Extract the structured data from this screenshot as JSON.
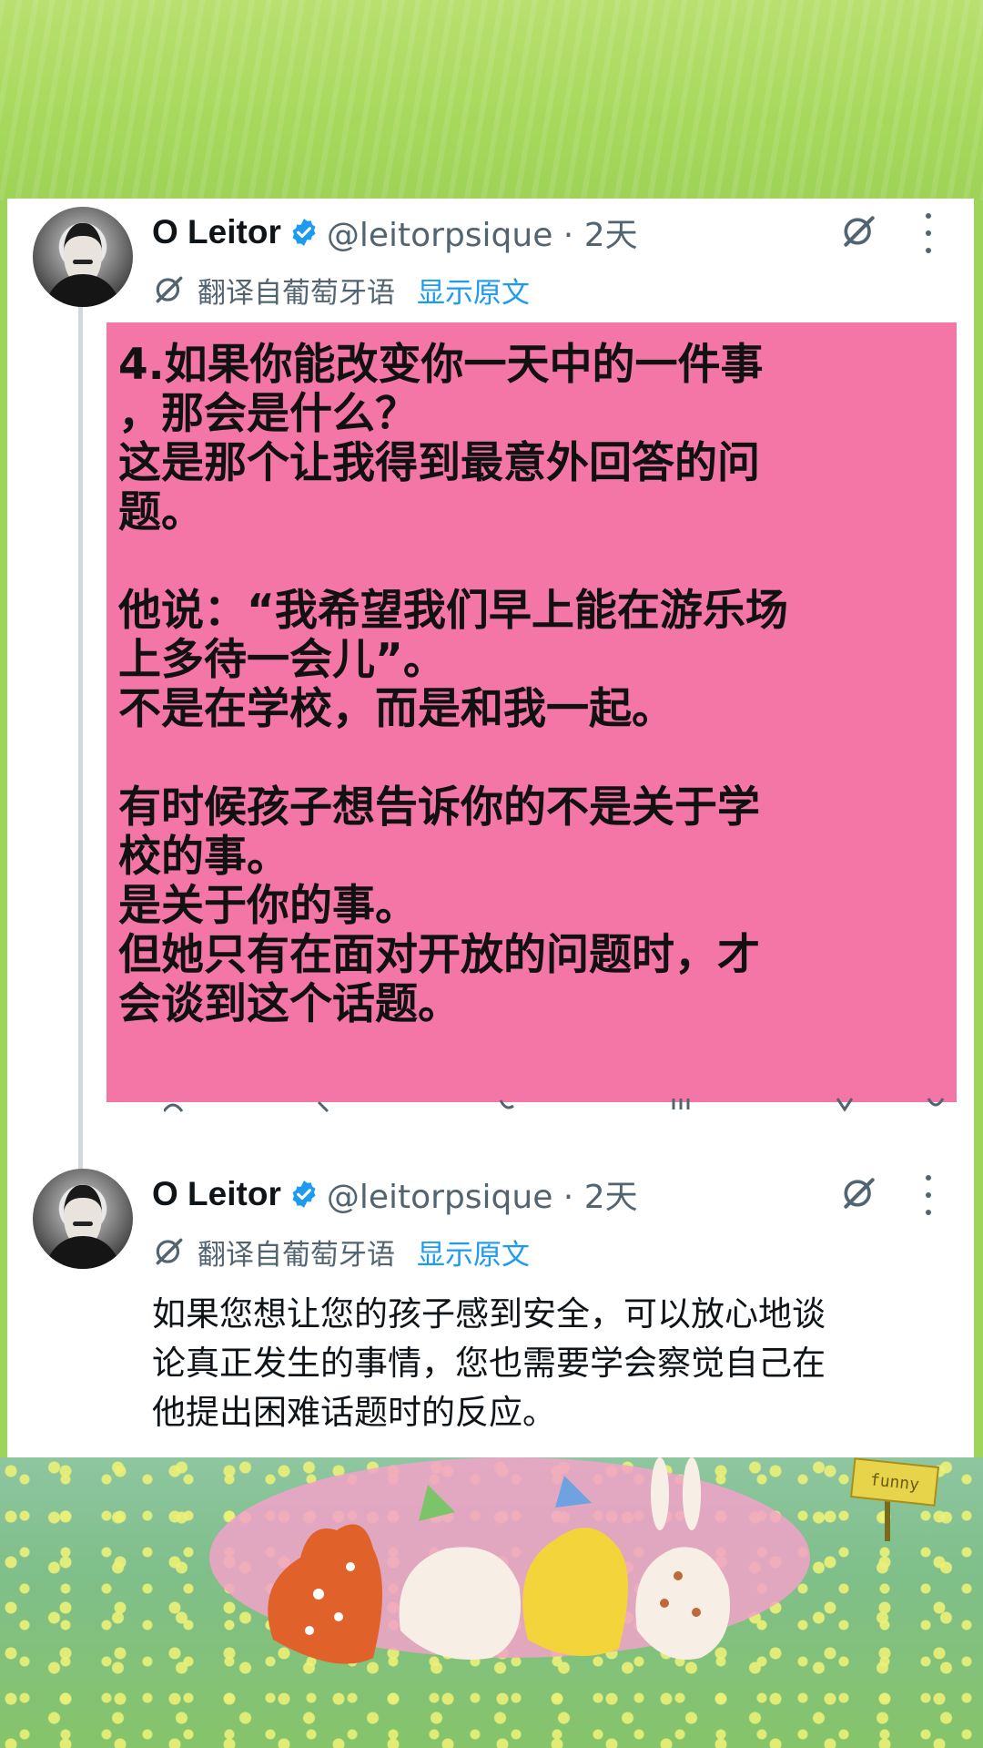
{
  "posts": [
    {
      "author_name": "O Leitor",
      "handle_time": "@leitorpsique · 2天",
      "translated_label": "翻译自葡萄牙语",
      "show_original": "显示原文",
      "content_paragraphs": [
        [
          "4.如果你能改变你一天中的一件事",
          "，那会是什么？",
          "这是那个让我得到最意外回答的问",
          "题。"
        ],
        [
          "他说：“我希望我们早上能在游乐场",
          "上多待一会儿”。",
          "不是在学校，而是和我一起。"
        ],
        [
          "有时候孩子想告诉你的不是关于学",
          "校的事。",
          "是关于你的事。",
          "但她只有在面对开放的问题时，才",
          "会谈到这个话题。"
        ]
      ]
    },
    {
      "author_name": "O Leitor",
      "handle_time": "@leitorpsique · 2天",
      "translated_label": "翻译自葡萄牙语",
      "show_original": "显示原文",
      "body_lines": [
        "如果您想让您的孩子感到安全，可以放心地谈",
        "论真正发生的事情，您也需要学会察觉自己在",
        "他提出困难话题时的反应。"
      ]
    }
  ],
  "illustration": {
    "sign_text": "funny"
  },
  "colors": {
    "highlight_pink": "#f476a6",
    "link_blue": "#1d9bf0",
    "verified_blue": "#1d9bf0",
    "muted_gray": "#536471"
  },
  "icons": [
    "verified-badge-icon",
    "grok-icon",
    "more-options-icon",
    "translate-icon"
  ]
}
